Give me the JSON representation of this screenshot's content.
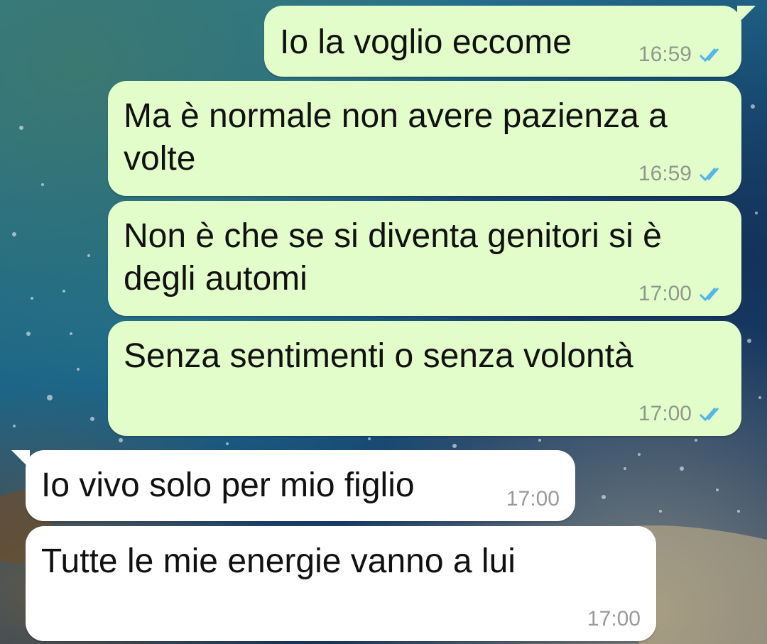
{
  "chat": {
    "messages": [
      {
        "direction": "outgoing",
        "text": "Io la voglio eccome",
        "time": "16:59",
        "status": "read"
      },
      {
        "direction": "outgoing",
        "text": "Ma è normale non avere pazienza a\nvolte",
        "time": "16:59",
        "status": "read"
      },
      {
        "direction": "outgoing",
        "text": "Non è che se si diventa genitori si è\ndegli automi",
        "time": "17:00",
        "status": "read"
      },
      {
        "direction": "outgoing",
        "text": "Senza sentimenti o senza volontà",
        "time": "17:00",
        "status": "read"
      },
      {
        "direction": "incoming",
        "text": "Io vivo solo per mio figlio",
        "time": "17:00"
      },
      {
        "direction": "incoming",
        "text": "Tutte le mie energie vanno a lui",
        "time": "17:00"
      }
    ]
  },
  "icons": {
    "read_receipt": "double-check-icon"
  },
  "colors": {
    "outgoing_bubble": "#e2fdc9",
    "incoming_bubble": "#ffffff",
    "read_tick": "#4fb6ec",
    "timestamp": "#8e9a8e"
  }
}
